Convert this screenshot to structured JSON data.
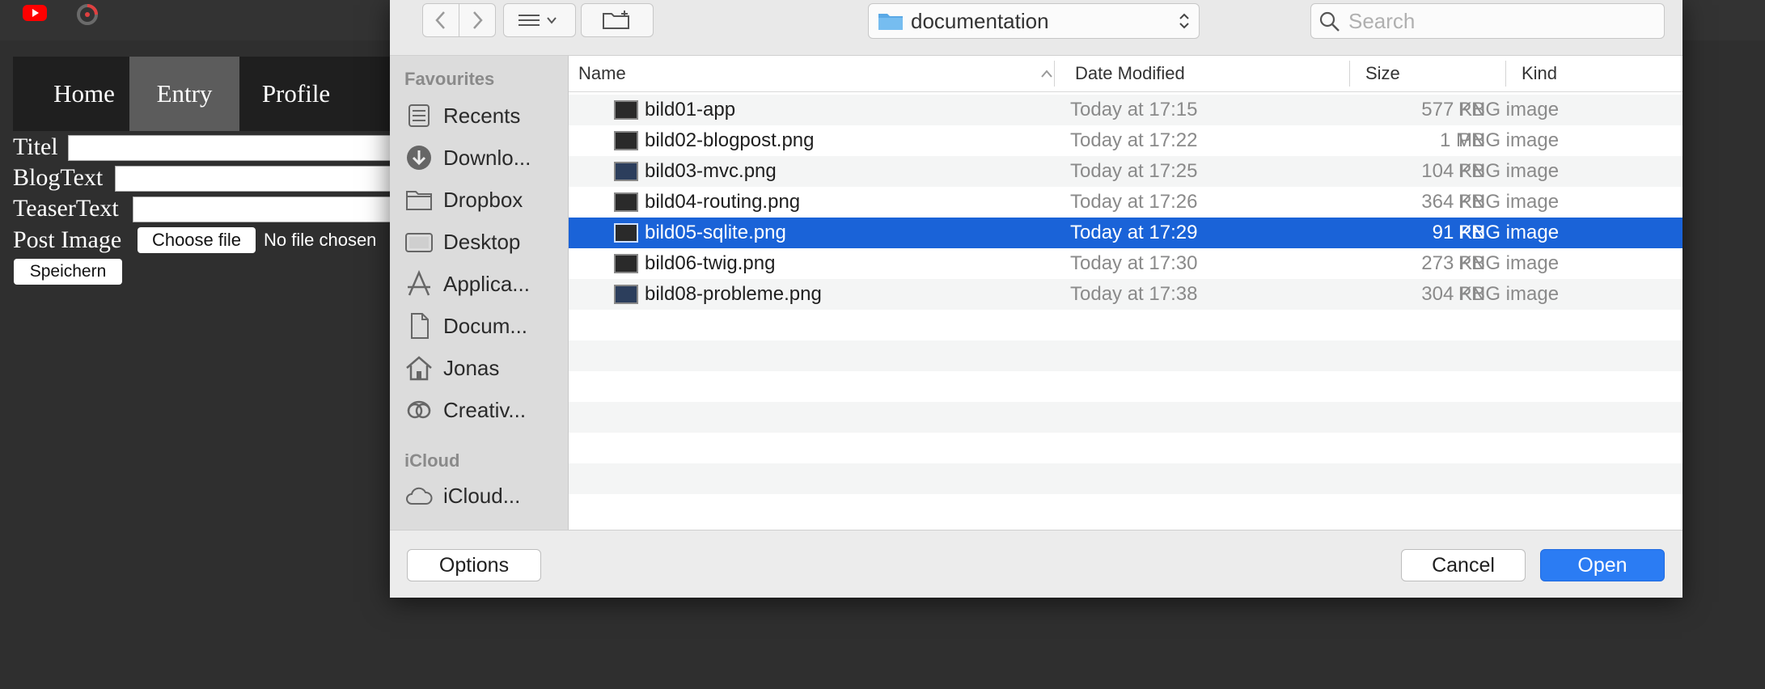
{
  "webpage": {
    "nav": {
      "home": "Home",
      "entry": "Entry",
      "profile": "Profile"
    },
    "form": {
      "title_label": "Titel",
      "blogtext_label": "BlogText",
      "teaser_label": "TeaserText",
      "image_label": "Post Image",
      "choose_file": "Choose file",
      "no_file": "No file chosen",
      "save": "Speichern"
    }
  },
  "dialog": {
    "location": "documentation",
    "search_placeholder": "Search",
    "sidebar": {
      "favourites_header": "Favourites",
      "favourites": [
        {
          "label": "Recents",
          "icon": "clock-icon"
        },
        {
          "label": "Downlo...",
          "icon": "download-icon"
        },
        {
          "label": "Dropbox",
          "icon": "folder-icon"
        },
        {
          "label": "Desktop",
          "icon": "desktop-icon"
        },
        {
          "label": "Applica...",
          "icon": "applications-icon"
        },
        {
          "label": "Docum...",
          "icon": "document-icon"
        },
        {
          "label": "Jonas",
          "icon": "home-icon"
        },
        {
          "label": "Creativ...",
          "icon": "creative-cloud-icon"
        }
      ],
      "icloud_header": "iCloud",
      "icloud": [
        {
          "label": "iCloud...",
          "icon": "cloud-icon"
        }
      ]
    },
    "columns": {
      "name": "Name",
      "date": "Date Modified",
      "size": "Size",
      "kind": "Kind"
    },
    "files": [
      {
        "name": "bild01-app",
        "date": "Today at 17:15",
        "size": "577 KB",
        "kind": "PNG image"
      },
      {
        "name": "bild02-blogpost.png",
        "date": "Today at 17:22",
        "size": "1 MB",
        "kind": "PNG image"
      },
      {
        "name": "bild03-mvc.png",
        "date": "Today at 17:25",
        "size": "104 KB",
        "kind": "PNG image"
      },
      {
        "name": "bild04-routing.png",
        "date": "Today at 17:26",
        "size": "364 KB",
        "kind": "PNG image"
      },
      {
        "name": "bild05-sqlite.png",
        "date": "Today at 17:29",
        "size": "91 KB",
        "kind": "PNG image"
      },
      {
        "name": "bild06-twig.png",
        "date": "Today at 17:30",
        "size": "273 KB",
        "kind": "PNG image"
      },
      {
        "name": "bild08-probleme.png",
        "date": "Today at 17:38",
        "size": "304 KB",
        "kind": "PNG image"
      }
    ],
    "selected_file": "bild05-sqlite.png",
    "buttons": {
      "options": "Options",
      "cancel": "Cancel",
      "open": "Open"
    },
    "colors": {
      "selection": "#1a63d8",
      "primary_button": "#2b7cf3",
      "folder": "#5aa9e6"
    }
  }
}
